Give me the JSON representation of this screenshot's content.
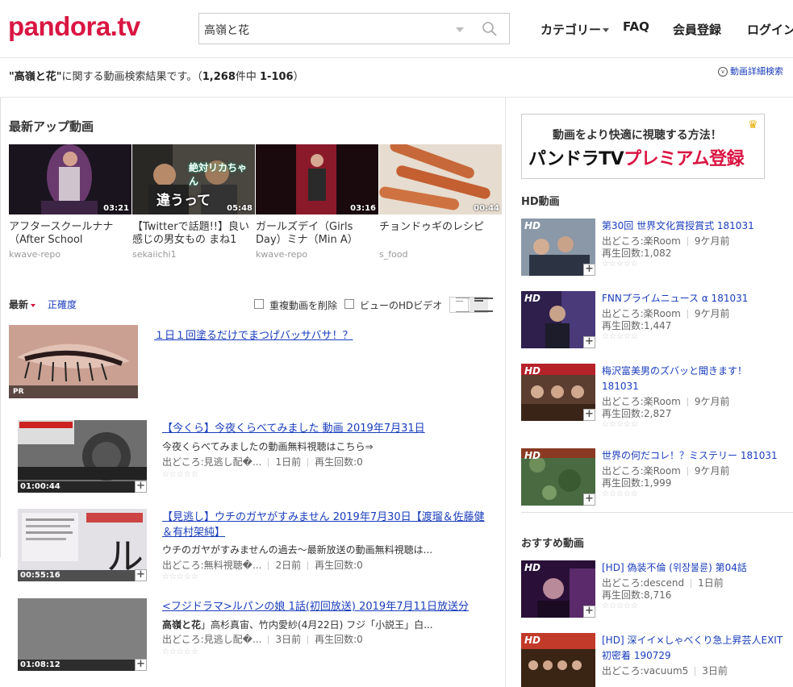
{
  "header": {
    "logo": "pandora.tv",
    "search_value": "高嶺と花",
    "nav": [
      "カテゴリー",
      "FAQ",
      "会員登録",
      "ログイン"
    ]
  },
  "summary": {
    "query": "\"高嶺と花\"",
    "text": "に関する動画検索結果です。（",
    "total": "1,268",
    "mid": "件中 ",
    "range": "1-106",
    "close": "）",
    "detail_search": "動画詳細検索"
  },
  "latest": {
    "title": "最新アップ動画",
    "items": [
      {
        "title": "アフタースクールナナ（After School",
        "user": "kwave-repo",
        "duration": "03:21",
        "color": "#2a2233"
      },
      {
        "title": "【Twitterで話題!!】良い感じの男女もの まね1",
        "user": "sekaiichi1",
        "duration": "05:48",
        "caption": "違うって",
        "caption2": "絶対リカちゃん",
        "color": "#3c3a36"
      },
      {
        "title": "ガールズデイ（Girls Day）ミナ（Min A）",
        "user": "kwave-repo",
        "duration": "03:16",
        "color": "#250d12"
      },
      {
        "title": "チョンドゥギのレシピ",
        "user": "s_food",
        "duration": "00:44",
        "color": "#b8623b"
      }
    ]
  },
  "sort": {
    "newest": "最新",
    "accuracy": "正確度",
    "dedupe": "重複動画を削除",
    "hd_view": "ビューのHDビデオ"
  },
  "ad": {
    "title": "１日１回塗るだけでまつげバッサバサ！？",
    "badge": "PR"
  },
  "results": [
    {
      "title": "【今くら】今夜くらべてみました 動画 2019年7月31日",
      "desc": "今夜くらべてみましたの動画無料視聴はこちら⇒",
      "source": "出どころ:見逃し配�...",
      "ago": "1日前",
      "views": "再生回数:0",
      "duration": "01:00:44",
      "color": "#555"
    },
    {
      "title": "【見逃し】ウチのガヤがすみません 2019年7月30日【渡瑠＆佐藤健＆有村架純】",
      "desc": "ウチのガヤがすみませんの過去～最新放送の動画無料視聴は...",
      "source": "出どころ:無料視聴�...",
      "ago": "2日前",
      "views": "再生回数:0",
      "duration": "00:55:16",
      "color": "#d8d2d8"
    },
    {
      "title": "<フジドラマ>ルパンの娘 1話(初回放送) 2019年7月11日放送分",
      "desc_bold": "高嶺と花",
      "desc": "」高杉真宙、竹内愛紗(4月22日) フジ「小説王」白...",
      "source": "出どころ:見逃し配�...",
      "ago": "3日前",
      "views": "再生回数:0",
      "duration": "01:08:12",
      "color": "#808080"
    }
  ],
  "sidebar": {
    "premium_line1": "動画をより快適に視聴する方法！",
    "premium_line2_a": "パンドラTV",
    "premium_line2_b": "プレミアム登録",
    "hd_title": "HD動画",
    "hd_items": [
      {
        "title": "第30回 世界文化賞授賞式 181031",
        "source": "出どころ:楽Room",
        "ago": "9ケ月前",
        "views": "再生回数:1,082",
        "color": "#6b7a8c"
      },
      {
        "title": "FNNプライムニュース α 181031",
        "source": "出どころ:楽Room",
        "ago": "9ケ月前",
        "views": "再生回数:1,447",
        "color": "#3b2c5e"
      },
      {
        "title": "梅沢富美男のズバッと聞きます！ 181031",
        "source": "出どころ:楽Room",
        "ago": "9ケ月前",
        "views": "再生回数:2,827",
        "color": "#5a3a2c"
      },
      {
        "title": "世界の何だコレ！？ミステリー 181031",
        "source": "出どころ:楽Room",
        "ago": "9ケ月前",
        "views": "再生回数:1,999",
        "color": "#3b5c3a"
      }
    ],
    "rec_title": "おすすめ動画",
    "rec_items": [
      {
        "title": "[HD] 偽装不倫 (위장불륜) 第04話",
        "source": "出どころ:descend",
        "ago": "1日前",
        "views": "再生回数:8,716",
        "color": "#3a1a4a"
      },
      {
        "title": "[HD] 深イイ×しゃべくり急上昇芸人EXIT初密着 190729",
        "source": "出どころ:vacuum5",
        "ago": "3日前",
        "views": "",
        "color": "#4a2b1a"
      }
    ],
    "hd_badge": "HD"
  },
  "icons": {
    "search": "search-icon",
    "plus": "add-icon",
    "star": "star-icon",
    "chevron": "chevron-down-icon"
  }
}
